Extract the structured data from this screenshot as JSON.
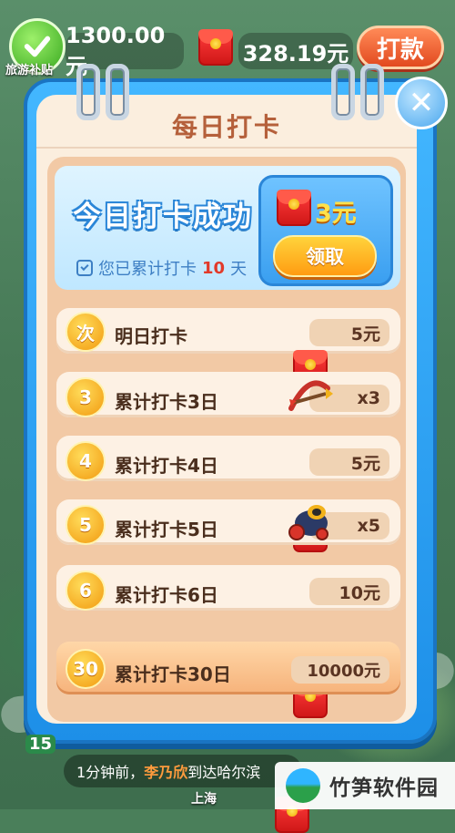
{
  "topbar": {
    "subsidy_label": "旅游补贴",
    "cash_amount": "1300.00元",
    "redpacket_amount": "328.19元",
    "withdraw_label": "打款"
  },
  "modal": {
    "title": "每日打卡",
    "today": {
      "status": "今日打卡成功",
      "streak_prefix": "您已累计打卡",
      "streak_days": "10",
      "streak_suffix": "天",
      "reward": "3元",
      "claim_label": "领取"
    },
    "rows": [
      {
        "badge": "次",
        "label": "明日打卡",
        "reward_icon": "red-envelope-icon",
        "amount": "5元"
      },
      {
        "badge": "3",
        "label": "累计打卡3日",
        "reward_icon": "crossbow-icon",
        "amount": "x3"
      },
      {
        "badge": "4",
        "label": "累计打卡4日",
        "reward_icon": "red-envelope-icon",
        "amount": "5元"
      },
      {
        "badge": "5",
        "label": "累计打卡5日",
        "reward_icon": "cannon-icon",
        "amount": "x5"
      },
      {
        "badge": "6",
        "label": "累计打卡6日",
        "reward_icon": "red-envelope-icon",
        "amount": "10元"
      },
      {
        "badge": "30",
        "label": "累计打卡30日",
        "reward_icon": "red-envelope-icon",
        "amount": "10000元"
      }
    ]
  },
  "ticker": {
    "time": "1分钟前，",
    "user": "李乃欣",
    "text": "到达哈尔滨"
  },
  "map": {
    "city_label": "上海",
    "side_number": "15"
  },
  "watermark": {
    "text": "竹笋软件园"
  },
  "colors": {
    "modal_blue": "#1d8fe8",
    "panel_cream": "#fbeede",
    "accent_orange": "#f29a10",
    "red_envelope": "#d01818"
  }
}
